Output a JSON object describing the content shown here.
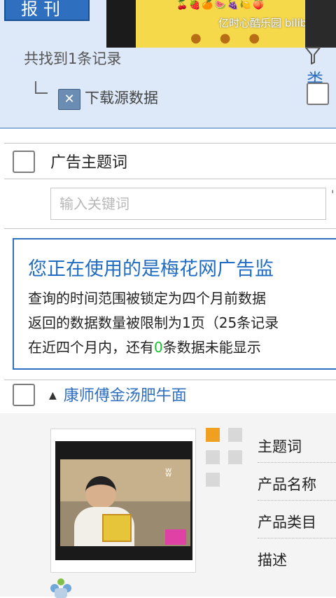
{
  "top_panel": {
    "tab_label": "报刊",
    "found_text": "共找到1条记录",
    "filter_label": "类",
    "download_label": "下载源数据"
  },
  "video_overlay": {
    "watermark": "亿时心酷乐园 bilibili"
  },
  "table": {
    "header_label": "广告主题词",
    "search_placeholder": "输入关键词"
  },
  "notice": {
    "title": "您正在使用的是梅花网广告监",
    "line1": "查询的时间范围被锁定为四个月前数据",
    "line2": "返回的数据数量被限制为1页（25条记录",
    "line3_pre": "在近四个月内，还有",
    "line3_count": "0",
    "line3_post": "条数据未能显示"
  },
  "product": {
    "title": "康师傅金汤肥牛面",
    "attributes": [
      "主题词",
      "产品名称",
      "产品类目",
      "描述"
    ]
  },
  "colors": {
    "accent_blue": "#2f6fc0",
    "panel_bg": "#dde9f9",
    "highlight_green": "#19c230",
    "active_square": "#f0a020"
  },
  "icons": {
    "filter": "filter-icon",
    "excel": "excel-icon",
    "expand": "triangle-up-icon"
  }
}
